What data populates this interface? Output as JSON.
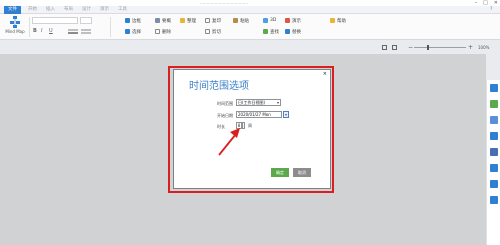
{
  "window": {
    "title": "………………………………",
    "controls": [
      "–",
      "□",
      "✕"
    ]
  },
  "menu": {
    "tabs": [
      "文件",
      "开始",
      "插入",
      "布局",
      "设计",
      "演示",
      "工具"
    ],
    "active_tab": "文件",
    "help": "?"
  },
  "ribbon": {
    "mindmap_label": "Mind Map",
    "format": {
      "bold": "B",
      "italic": "I",
      "underline": "U"
    },
    "buttons": {
      "boundary": "边框",
      "summary": "要概",
      "arrange": "整理",
      "copy": "复印",
      "paste": "粘贴",
      "three_d": "3D",
      "presentation": "演示",
      "help": "帮助",
      "select": "选择",
      "delete": "删除",
      "cut": "剪切",
      "find": "查找",
      "replace": "替换"
    }
  },
  "canvas": {
    "zoom": "100%"
  },
  "dialog": {
    "title": "时间范围选项",
    "close": "×",
    "fields": {
      "time_range_label": "时间范围",
      "time_range_value": "日(工作日视图)",
      "start_date_label": "开始日期",
      "start_date_value": "2020/01/27 Mon",
      "date_button": "▾",
      "hour_label": "时长",
      "hour_value": "8",
      "hour_unit": "周"
    },
    "ok": "确定",
    "cancel": "取消"
  },
  "colors": {
    "accent": "#2f7fd2",
    "title": "#3b7fc6",
    "highlight": "#d9201f",
    "ok": "#5aa94d",
    "cancel": "#8c8c8c"
  }
}
